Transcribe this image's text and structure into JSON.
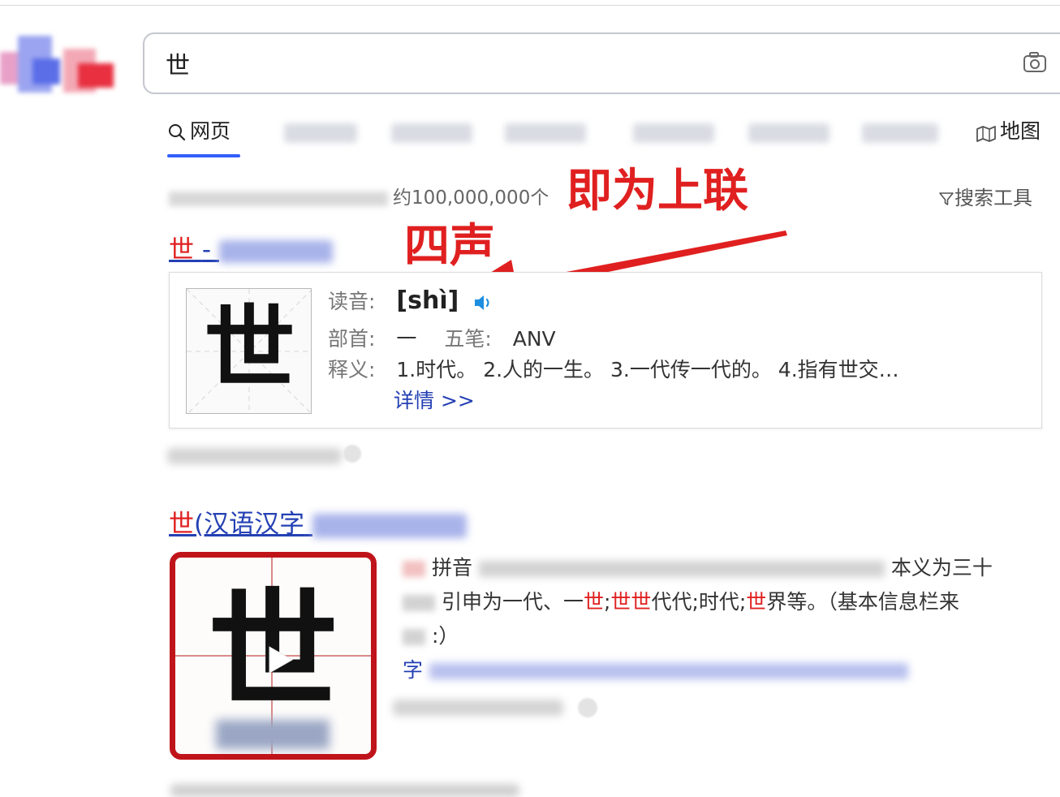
{
  "search": {
    "query": "世"
  },
  "tabs": [
    {
      "label": "网页",
      "active": true,
      "icon": "search-icon"
    },
    {
      "label": "",
      "icon": "news-icon"
    },
    {
      "label": "",
      "icon": "video-icon"
    },
    {
      "label": "",
      "icon": "image-icon"
    },
    {
      "label": "",
      "icon": "zhidao-icon"
    },
    {
      "label": "",
      "icon": "wenku-icon"
    },
    {
      "label": "",
      "icon": "tieba-icon"
    },
    {
      "label": "地图",
      "icon": "map-icon"
    }
  ],
  "result_count": "约100,000,000个",
  "search_tools": "搜索工具",
  "annotations": {
    "line1": "即为上联",
    "line2": "四声",
    "color": "#e02020"
  },
  "result1": {
    "title_char": "世",
    "title_sep": "-",
    "card": {
      "big_char": "世",
      "reading_label": "读音:",
      "pinyin": "[shì]",
      "radical_label": "部首:",
      "radical": "一",
      "wubi_label": "五笔:",
      "wubi": "ANV",
      "meaning_label": "释义:",
      "meanings": "1.时代。 2.人的一生。 3.一代传一代的。 4.指有世交…",
      "detail_link": "详情 >>"
    }
  },
  "result2": {
    "title_char": "世",
    "title_rest": "(汉语汉字",
    "video_char": "世",
    "snippet": {
      "line1_mid": "拼音",
      "line1_end": "本义为三十",
      "line2_a": "引申为一代、一",
      "line2_em1": "世",
      "line2_b": ";",
      "line2_em2": "世世",
      "line2_c": "代代;时代;",
      "line2_em3": "世",
      "line2_d": "界等。（基本信息栏来",
      "line3": ":）",
      "line4_start": "字"
    }
  },
  "colors": {
    "link": "#2440b3",
    "highlight": "#e02020",
    "tab_active": "#315efb",
    "video_border": "#c0141b",
    "speaker": "#1d8ee0"
  }
}
